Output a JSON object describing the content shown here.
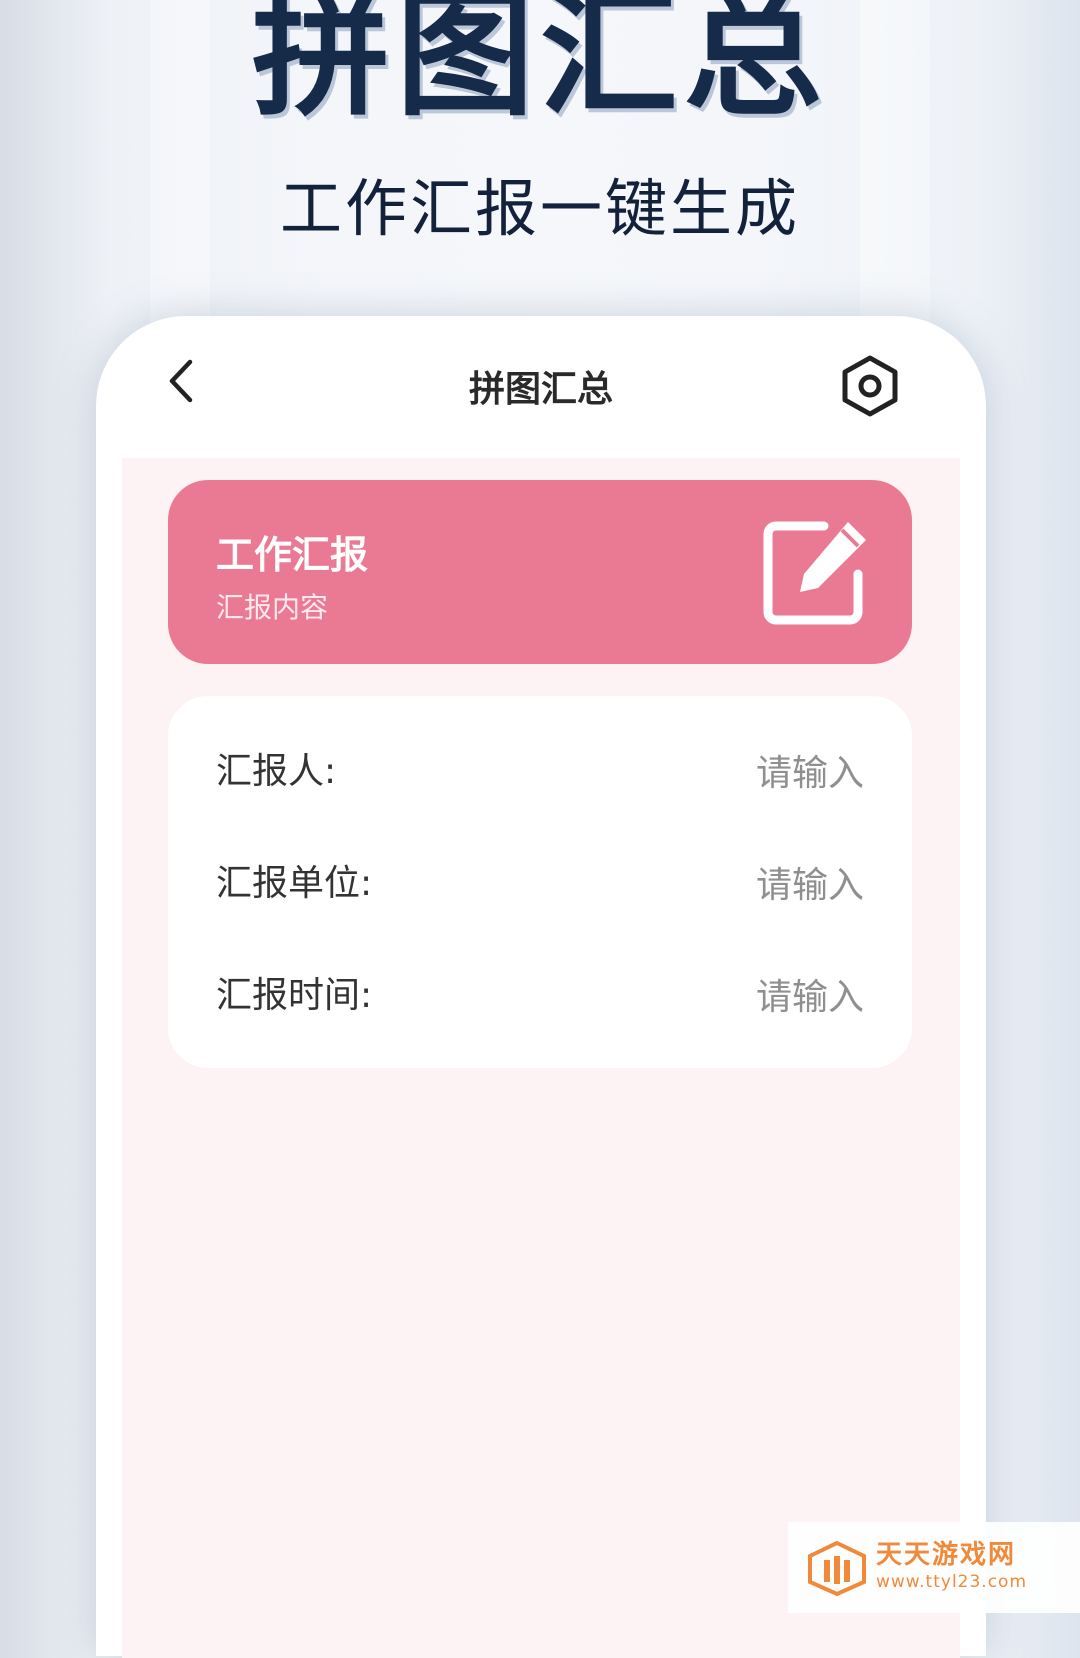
{
  "promo": {
    "title": "拼图汇总",
    "subtitle": "工作汇报一键生成"
  },
  "header": {
    "title": "拼图汇总",
    "back_icon": "chevron-left-icon",
    "settings_icon": "hexagon-settings-icon"
  },
  "report_card": {
    "title": "工作汇报",
    "subtitle": "汇报内容",
    "icon": "edit-icon",
    "color": "#ea7a93"
  },
  "form": {
    "fields": [
      {
        "label": "汇报人:",
        "placeholder": "请输入",
        "value": ""
      },
      {
        "label": "汇报单位:",
        "placeholder": "请输入",
        "value": ""
      },
      {
        "label": "汇报时间:",
        "placeholder": "请输入",
        "value": ""
      }
    ]
  },
  "watermark": {
    "name": "天天游戏网",
    "url": "www.ttyl23.com"
  },
  "colors": {
    "app_background": "#fdf2f4",
    "promo_text": "#162a4a",
    "accent": "#ea7a93"
  }
}
